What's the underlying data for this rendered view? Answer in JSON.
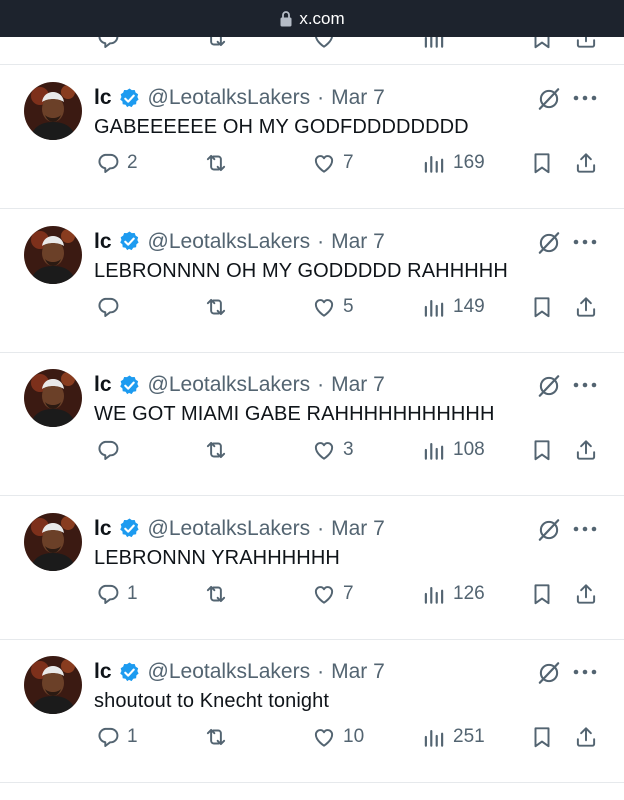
{
  "browser": {
    "url": "x.com"
  },
  "author": {
    "name": "lc",
    "handle": "@LeotalksLakers",
    "verified": true
  },
  "icons": {
    "lock": "lock-icon",
    "verified": "verified-badge-icon",
    "grok": "grok-icon",
    "more": "more-icon",
    "reply": "reply-icon",
    "retweet": "retweet-icon",
    "like": "like-icon",
    "views": "views-icon",
    "bookmark": "bookmark-icon",
    "share": "share-icon"
  },
  "colors": {
    "text": "#0f1419",
    "secondary": "#536471",
    "verified": "#1d9bf0",
    "urlbar": "#1d232d",
    "divider": "#e6e9ec"
  },
  "tweets": [
    {
      "date": "Mar 7",
      "text": "GABEEEEEE OH MY GODFDDDDDDDD",
      "replies": "2",
      "likes": "7",
      "views": "169"
    },
    {
      "date": "Mar 7",
      "text": "LEBRONNNN OH MY GODDDDD RAHHHHH",
      "replies": "",
      "likes": "5",
      "views": "149"
    },
    {
      "date": "Mar 7",
      "text": "WE GOT MIAMI GABE RAHHHHHHHHHHH",
      "replies": "",
      "likes": "3",
      "views": "108"
    },
    {
      "date": "Mar 7",
      "text": "LEBRONNN YRAHHHHHH",
      "replies": "1",
      "likes": "7",
      "views": "126"
    },
    {
      "date": "Mar 7",
      "text": "shoutout to Knecht tonight",
      "replies": "1",
      "likes": "10",
      "views": "251"
    }
  ]
}
